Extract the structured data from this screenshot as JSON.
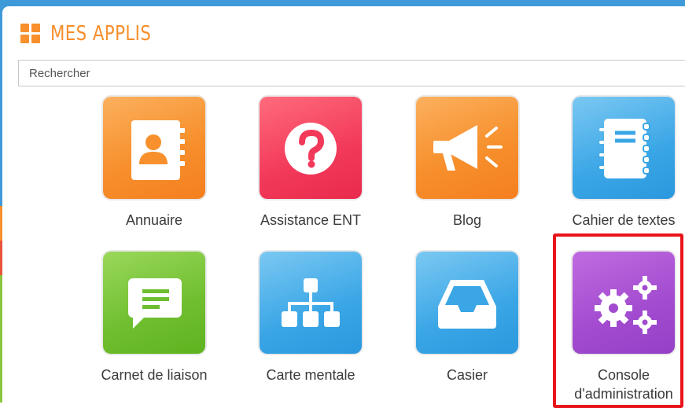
{
  "header": {
    "title": "MES APPLIS",
    "icon": "grid-icon",
    "accent_color": "#f7902d"
  },
  "search": {
    "placeholder": "Rechercher",
    "value": ""
  },
  "apps": [
    {
      "label": "Annuaire",
      "icon": "address-book-icon",
      "color": "#f7902d"
    },
    {
      "label": "Assistance ENT",
      "icon": "question-icon",
      "color": "#f2395a"
    },
    {
      "label": "Blog",
      "icon": "megaphone-icon",
      "color": "#f7902d"
    },
    {
      "label": "Cahier de textes",
      "icon": "notebook-icon",
      "color": "#3aa6e6"
    },
    {
      "label": "Carnet de liaison",
      "icon": "chat-bubble-icon",
      "color": "#6fbe2f"
    },
    {
      "label": "Carte mentale",
      "icon": "sitemap-icon",
      "color": "#3aa6e6"
    },
    {
      "label": "Casier",
      "icon": "inbox-tray-icon",
      "color": "#3aa6e6"
    },
    {
      "label": "Console d'administration",
      "icon": "gears-icon",
      "color": "#a24bd0",
      "highlighted": true
    }
  ],
  "highlight_color": "#e8141b"
}
